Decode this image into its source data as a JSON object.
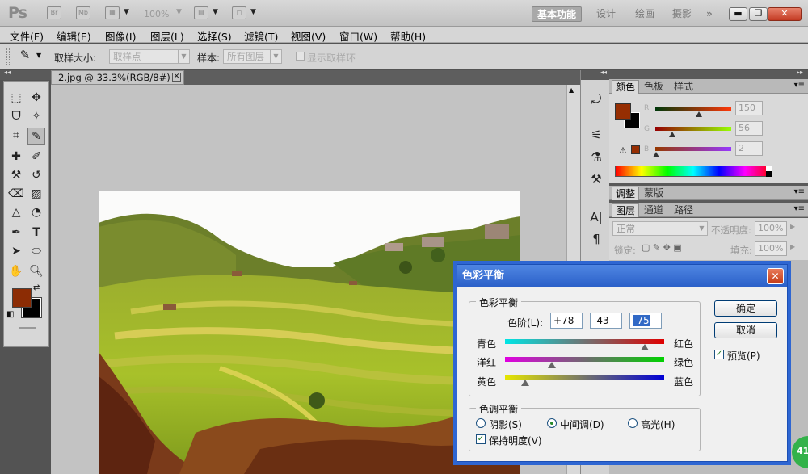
{
  "app": {
    "logo": "Ps",
    "zoom": "100%"
  },
  "workspaces": [
    "基本功能",
    "设计",
    "绘画",
    "摄影",
    "»"
  ],
  "menu": [
    "文件(F)",
    "编辑(E)",
    "图像(I)",
    "图层(L)",
    "选择(S)",
    "滤镜(T)",
    "视图(V)",
    "窗口(W)",
    "帮助(H)"
  ],
  "options": {
    "sample_size_label": "取样大小:",
    "sample_size_value": "取样点",
    "sample_label": "样本:",
    "sample_value": "所有图层",
    "show_ring": "显示取样环"
  },
  "document": {
    "tab": "2.jpg @ 33.3%(RGB/8#)"
  },
  "color_panel": {
    "tabs": [
      "颜色",
      "色板",
      "样式"
    ],
    "channels": [
      {
        "name": "R",
        "value": "150"
      },
      {
        "name": "G",
        "value": "56"
      },
      {
        "name": "B",
        "value": "2"
      }
    ],
    "fg_color": "#962e02",
    "bg_color": "#000000"
  },
  "adjust_panel": {
    "tabs": [
      "调整",
      "蒙版"
    ]
  },
  "layers_panel": {
    "tabs": [
      "图层",
      "通道",
      "路径"
    ],
    "blend_mode": "正常",
    "opacity_label": "不透明度:",
    "opacity_value": "100%",
    "lock_label": "锁定:",
    "fill_label": "填充:",
    "fill_value": "100%"
  },
  "dialog": {
    "title": "色彩平衡",
    "balance_group": "色彩平衡",
    "levels_label": "色阶(L):",
    "levels": [
      "+78",
      "-43",
      "-75"
    ],
    "sliders": [
      {
        "left": "青色",
        "right": "红色",
        "value": 78
      },
      {
        "left": "洋红",
        "right": "绿色",
        "value": -43
      },
      {
        "left": "黄色",
        "right": "蓝色",
        "value": -75
      }
    ],
    "tone_group": "色调平衡",
    "tones": [
      "阴影(S)",
      "中间调(D)",
      "高光(H)"
    ],
    "selected_tone": "中间调(D)",
    "preserve_luminosity": "保持明度(V)",
    "ok": "确定",
    "cancel": "取消",
    "preview": "预览(P)"
  },
  "badge": "41"
}
